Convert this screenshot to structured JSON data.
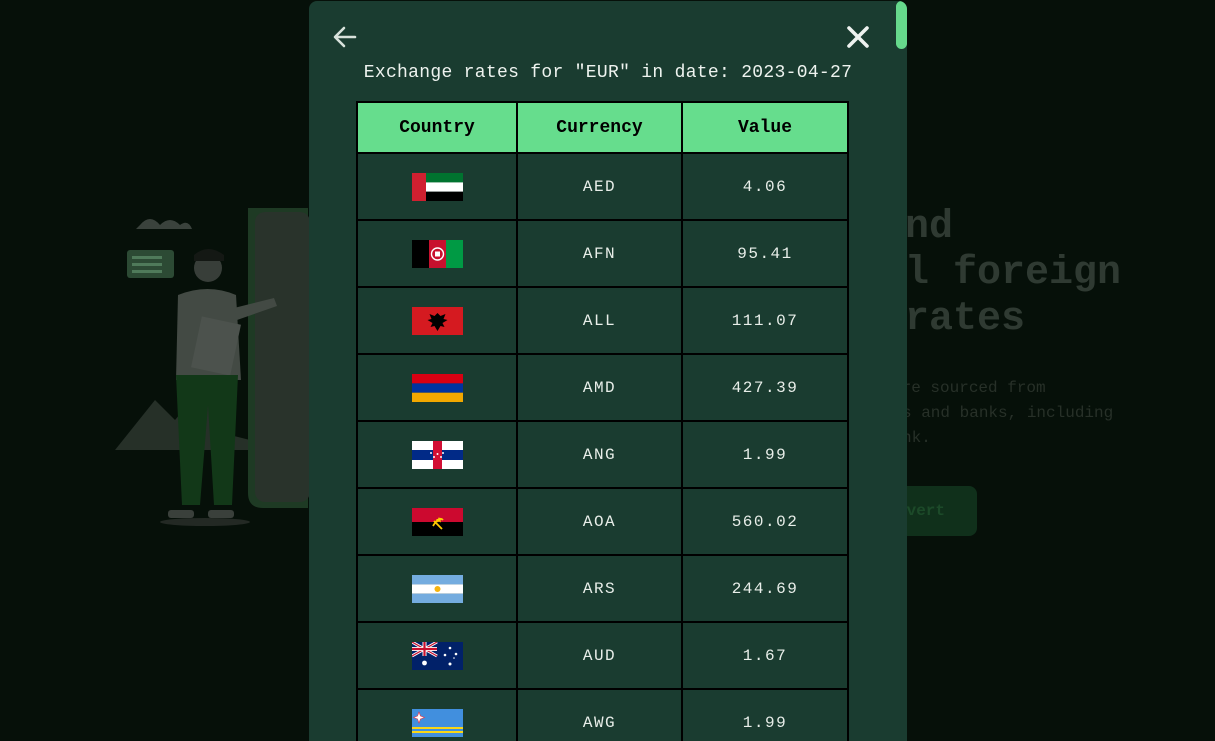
{
  "background": {
    "headline_lines": [
      "nd",
      "l foreign",
      "rates"
    ],
    "description_lines": [
      "are sourced from",
      "s and banks, including",
      "nk."
    ],
    "convert_label": "vert"
  },
  "modal": {
    "back_icon": "arrow-left-icon",
    "close_icon": "close-icon",
    "title": "Exchange rates for \"EUR\" in date: 2023-04-27",
    "columns": [
      "Country",
      "Currency",
      "Value"
    ],
    "rows": [
      {
        "flag": "uae-flag",
        "currency": "AED",
        "value": "4.06"
      },
      {
        "flag": "afghanistan-flag",
        "currency": "AFN",
        "value": "95.41"
      },
      {
        "flag": "albania-flag",
        "currency": "ALL",
        "value": "111.07"
      },
      {
        "flag": "armenia-flag",
        "currency": "AMD",
        "value": "427.39"
      },
      {
        "flag": "netherlands-antilles-flag",
        "currency": "ANG",
        "value": "1.99"
      },
      {
        "flag": "angola-flag",
        "currency": "AOA",
        "value": "560.02"
      },
      {
        "flag": "argentina-flag",
        "currency": "ARS",
        "value": "244.69"
      },
      {
        "flag": "australia-flag",
        "currency": "AUD",
        "value": "1.67"
      },
      {
        "flag": "aruba-flag",
        "currency": "AWG",
        "value": "1.99"
      }
    ]
  },
  "colors": {
    "modal_bg": "#1a3c30",
    "header_bg": "#66dd8d",
    "accent": "#66d98c",
    "overlay": "#061009"
  }
}
